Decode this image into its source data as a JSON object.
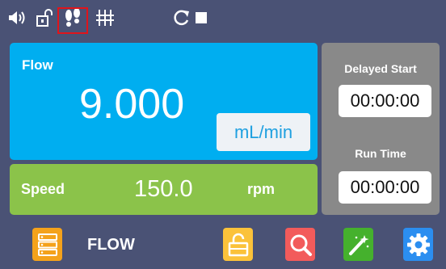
{
  "topbar": {
    "icons": [
      "speaker-icon",
      "unlock-icon",
      "footprints-icon",
      "tuning-icon",
      "refresh-icon",
      "stop-icon"
    ],
    "highlight_color": "#e0141b"
  },
  "flow": {
    "label": "Flow",
    "value": "9.000",
    "unit": "mL/min",
    "color": "#00aef0"
  },
  "speed": {
    "label": "Speed",
    "value": "150.0",
    "unit": "rpm",
    "color": "#8bc34a"
  },
  "delayed_start": {
    "label": "Delayed Start",
    "time": "00:00:00"
  },
  "run_time": {
    "label": "Run Time",
    "time": "00:00:00"
  },
  "bottombar": {
    "mode_label": "FLOW",
    "buttons": [
      {
        "icon": "menu-list-icon",
        "color": "#f4a21b"
      },
      {
        "icon": "unlock-icon",
        "color": "#fbc23a"
      },
      {
        "icon": "search-icon",
        "color": "#f25b5b"
      },
      {
        "icon": "magic-wand-icon",
        "color": "#45b12d"
      },
      {
        "icon": "gear-icon",
        "color": "#2b8ef0"
      }
    ]
  }
}
